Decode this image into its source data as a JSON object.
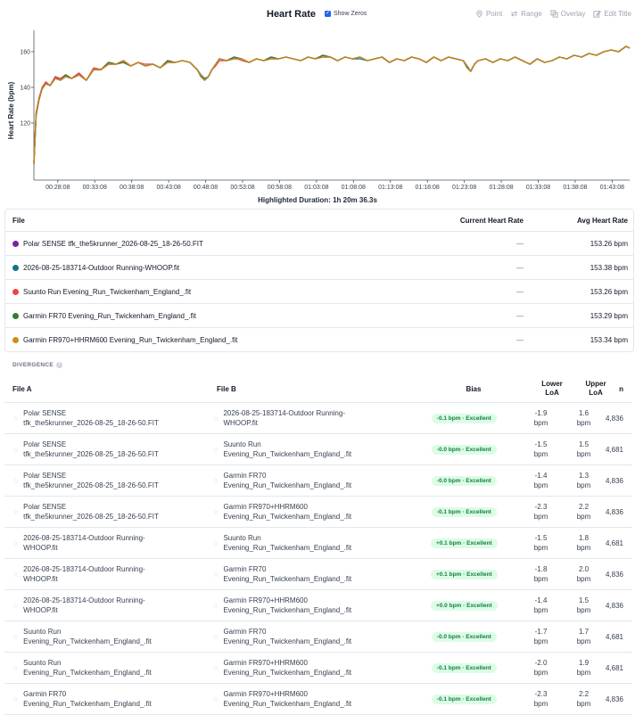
{
  "header": {
    "title": "Heart Rate",
    "show_zeros_label": "Show Zeros",
    "tools": [
      {
        "label": "Point",
        "icon": "pin-icon"
      },
      {
        "label": "Range",
        "icon": "range-icon"
      },
      {
        "label": "Overlay",
        "icon": "overlay-icon"
      },
      {
        "label": "Edit Title",
        "icon": "edit-icon"
      }
    ]
  },
  "chart_data": {
    "type": "line",
    "title": "Heart Rate",
    "ylabel": "Heart Rate (bpm)",
    "xlabel": "Highlighted Duration: 1h 20m 36.3s",
    "x_tick_labels": [
      "00:28:08",
      "00:33:08",
      "00:38:08",
      "00:43:08",
      "00:48:08",
      "00:53:08",
      "00:58:08",
      "01:03:08",
      "01:08:08",
      "01:13:08",
      "01:18:08",
      "01:23:08",
      "01:28:08",
      "01:33:08",
      "01:38:08",
      "01:43:08"
    ],
    "y_ticks": [
      120,
      140,
      160
    ],
    "ylim": [
      88,
      172
    ],
    "x_minutes": [
      24.9,
      25.2,
      25.6,
      26.0,
      26.5,
      27.1,
      27.8,
      28.5,
      29.2,
      30.0,
      31.0,
      32.0,
      33.0,
      34.0,
      35.0,
      36.0,
      37.0,
      38.0,
      39.0,
      40.0,
      41.0,
      42.0,
      43.0,
      44.0,
      45.0,
      46.0,
      47.0,
      47.5,
      48.0,
      48.5,
      49.0,
      49.5,
      50.0,
      51.0,
      52.0,
      53.0,
      54.0,
      55.0,
      56.0,
      57.0,
      58.0,
      59.0,
      60.0,
      61.0,
      62.0,
      63.0,
      64.0,
      65.0,
      66.0,
      67.0,
      68.0,
      69.0,
      70.0,
      71.0,
      72.0,
      73.0,
      74.0,
      75.0,
      76.0,
      77.0,
      78.0,
      79.0,
      80.0,
      81.0,
      82.0,
      83.0,
      83.5,
      84.0,
      84.5,
      85.0,
      86.0,
      87.0,
      88.0,
      89.0,
      90.0,
      91.0,
      92.0,
      93.0,
      94.0,
      95.0,
      96.0,
      97.0,
      98.0,
      99.0,
      100.0,
      101.0,
      102.0,
      103.0,
      104.0,
      105.0,
      105.5
    ],
    "series": [
      {
        "name": "Polar SENSE tfk_the5krunner_2026-08-25_18-26-50.FIT",
        "color": "#7b1fa2",
        "values": [
          98,
          125,
          134,
          139,
          143,
          141,
          146,
          144,
          147,
          145,
          148,
          144,
          150,
          150,
          154,
          153,
          155,
          152,
          154,
          152,
          153,
          151,
          155,
          154,
          155,
          154,
          150,
          146,
          144,
          146,
          150,
          153,
          156,
          155,
          157,
          156,
          154,
          156,
          155,
          157,
          156,
          157,
          156,
          155,
          157,
          156,
          158,
          157,
          155,
          157,
          156,
          157,
          155,
          156,
          157,
          154,
          156,
          155,
          157,
          156,
          154,
          157,
          155,
          157,
          156,
          155,
          151,
          149,
          153,
          155,
          156,
          154,
          156,
          155,
          157,
          155,
          153,
          156,
          154,
          155,
          157,
          156,
          158,
          157,
          159,
          158,
          160,
          161,
          160,
          163,
          162
        ]
      },
      {
        "name": "2026-08-25-183714-Outdoor Running-WHOOP.fit",
        "color": "#0e7490",
        "values": [
          97,
          124,
          133,
          139,
          142,
          141,
          145,
          144,
          146,
          145,
          147,
          144,
          150,
          150,
          153,
          153,
          154,
          152,
          154,
          152,
          153,
          151,
          154,
          154,
          155,
          154,
          150,
          147,
          145,
          146,
          150,
          153,
          156,
          155,
          156,
          156,
          154,
          156,
          155,
          156,
          156,
          157,
          156,
          155,
          157,
          156,
          157,
          157,
          155,
          157,
          156,
          156,
          155,
          156,
          157,
          154,
          156,
          155,
          157,
          156,
          154,
          157,
          155,
          157,
          156,
          155,
          152,
          149,
          153,
          155,
          156,
          154,
          156,
          155,
          157,
          155,
          153,
          156,
          154,
          155,
          157,
          156,
          158,
          157,
          159,
          158,
          160,
          161,
          160,
          163,
          162
        ]
      },
      {
        "name": "Suunto Run Evening_Run_Twickenham_England_.fit",
        "color": "#ef4444",
        "values": [
          98,
          126,
          134,
          140,
          143,
          141,
          146,
          145,
          147,
          145,
          148,
          144,
          151,
          150,
          154,
          153,
          155,
          152,
          154,
          153,
          153,
          151,
          155,
          154,
          155,
          154,
          150,
          146,
          144,
          146,
          150,
          152,
          155,
          155,
          157,
          155,
          154,
          156,
          155,
          157,
          156,
          157,
          156,
          155,
          157,
          156,
          158,
          157,
          155,
          157,
          156,
          157,
          155,
          156,
          157,
          154,
          156,
          155,
          157,
          156,
          154,
          157,
          155,
          157,
          156,
          155,
          151,
          149,
          153,
          155,
          156,
          154,
          156,
          155,
          157,
          155,
          153,
          156,
          154,
          155,
          157,
          156,
          158,
          157,
          159,
          158,
          160,
          161,
          160,
          163,
          162
        ]
      },
      {
        "name": "Garmin FR70 Evening_Run_Twickenham_England_.fit",
        "color": "#2e7d32",
        "values": [
          97,
          125,
          133,
          139,
          142,
          141,
          145,
          144,
          147,
          145,
          147,
          144,
          150,
          150,
          154,
          153,
          154,
          152,
          154,
          152,
          153,
          151,
          155,
          154,
          155,
          154,
          150,
          146,
          144,
          146,
          150,
          153,
          156,
          155,
          157,
          156,
          154,
          156,
          155,
          157,
          156,
          157,
          156,
          155,
          157,
          156,
          158,
          157,
          155,
          157,
          156,
          157,
          155,
          156,
          157,
          154,
          156,
          155,
          157,
          156,
          154,
          157,
          155,
          157,
          156,
          155,
          151,
          149,
          153,
          155,
          156,
          154,
          156,
          155,
          157,
          155,
          153,
          156,
          154,
          155,
          157,
          156,
          158,
          157,
          159,
          158,
          160,
          161,
          160,
          163,
          162
        ]
      },
      {
        "name": "Garmin FR970+HHRM600 Evening_Run_Twickenham_England_.fit",
        "color": "#d4881a",
        "values": [
          97,
          125,
          133,
          139,
          142,
          141,
          145,
          144,
          146,
          145,
          147,
          144,
          150,
          150,
          153,
          153,
          155,
          152,
          154,
          152,
          153,
          151,
          154,
          154,
          155,
          154,
          150,
          146,
          144,
          146,
          150,
          153,
          156,
          155,
          156,
          156,
          154,
          156,
          155,
          156,
          156,
          157,
          156,
          155,
          157,
          156,
          157,
          157,
          155,
          157,
          156,
          157,
          155,
          156,
          157,
          154,
          156,
          155,
          157,
          156,
          154,
          157,
          155,
          157,
          156,
          155,
          151,
          149,
          153,
          155,
          156,
          154,
          156,
          155,
          157,
          155,
          153,
          156,
          154,
          155,
          157,
          156,
          158,
          157,
          159,
          158,
          160,
          161,
          160,
          163,
          162
        ]
      }
    ]
  },
  "file_table": {
    "headers": {
      "file": "File",
      "current": "Current Heart Rate",
      "avg": "Avg Heart Rate"
    },
    "rows": [
      {
        "file": "Polar SENSE tfk_the5krunner_2026-08-25_18-26-50.FIT",
        "color": "#7b1fa2",
        "current": "—",
        "avg": "153.26 bpm"
      },
      {
        "file": "2026-08-25-183714-Outdoor Running-WHOOP.fit",
        "color": "#0e7490",
        "current": "—",
        "avg": "153.38 bpm"
      },
      {
        "file": "Suunto Run Evening_Run_Twickenham_England_.fit",
        "color": "#ef4444",
        "current": "—",
        "avg": "153.26 bpm"
      },
      {
        "file": "Garmin FR70 Evening_Run_Twickenham_England_.fit",
        "color": "#2e7d32",
        "current": "—",
        "avg": "153.29 bpm"
      },
      {
        "file": "Garmin FR970+HHRM600 Evening_Run_Twickenham_England_.fit",
        "color": "#d4881a",
        "current": "—",
        "avg": "153.34 bpm"
      }
    ]
  },
  "divergence": {
    "title": "DIVERGENCE",
    "headers": {
      "file_a": "File A",
      "file_b": "File B",
      "bias": "Bias",
      "lower_1": "Lower",
      "lower_2": "LoA",
      "upper_1": "Upper",
      "upper_2": "LoA",
      "n": "n"
    },
    "rows": [
      {
        "a1": "Polar SENSE",
        "a2": "tfk_the5krunner_2026-08-25_18-26-50.FIT",
        "b1": "2026-08-25-183714-Outdoor Running-",
        "b2": "WHOOP.fit",
        "bias": "-0.1 bpm · Excellent",
        "lo1": "-1.9",
        "lo2": "bpm",
        "up1": "1.6",
        "up2": "bpm",
        "n": "4,836"
      },
      {
        "a1": "Polar SENSE",
        "a2": "tfk_the5krunner_2026-08-25_18-26-50.FIT",
        "b1": "Suunto Run",
        "b2": "Evening_Run_Twickenham_England_.fit",
        "bias": "-0.0 bpm · Excellent",
        "lo1": "-1.5",
        "lo2": "bpm",
        "up1": "1.5",
        "up2": "bpm",
        "n": "4,681"
      },
      {
        "a1": "Polar SENSE",
        "a2": "tfk_the5krunner_2026-08-25_18-26-50.FIT",
        "b1": "Garmin FR70",
        "b2": "Evening_Run_Twickenham_England_.fit",
        "bias": "-0.0 bpm · Excellent",
        "lo1": "-1.4",
        "lo2": "bpm",
        "up1": "1.3",
        "up2": "bpm",
        "n": "4,836"
      },
      {
        "a1": "Polar SENSE",
        "a2": "tfk_the5krunner_2026-08-25_18-26-50.FIT",
        "b1": "Garmin FR970+HHRM600",
        "b2": "Evening_Run_Twickenham_England_.fit",
        "bias": "-0.1 bpm · Excellent",
        "lo1": "-2.3",
        "lo2": "bpm",
        "up1": "2.2",
        "up2": "bpm",
        "n": "4,836"
      },
      {
        "a1": "2026-08-25-183714-Outdoor Running-",
        "a2": "WHOOP.fit",
        "b1": "Suunto Run",
        "b2": "Evening_Run_Twickenham_England_.fit",
        "bias": "+0.1 bpm · Excellent",
        "lo1": "-1.5",
        "lo2": "bpm",
        "up1": "1.8",
        "up2": "bpm",
        "n": "4,681"
      },
      {
        "a1": "2026-08-25-183714-Outdoor Running-",
        "a2": "WHOOP.fit",
        "b1": "Garmin FR70",
        "b2": "Evening_Run_Twickenham_England_.fit",
        "bias": "+0.1 bpm · Excellent",
        "lo1": "-1.8",
        "lo2": "bpm",
        "up1": "2.0",
        "up2": "bpm",
        "n": "4,836"
      },
      {
        "a1": "2026-08-25-183714-Outdoor Running-",
        "a2": "WHOOP.fit",
        "b1": "Garmin FR970+HHRM600",
        "b2": "Evening_Run_Twickenham_England_.fit",
        "bias": "+0.0 bpm · Excellent",
        "lo1": "-1.4",
        "lo2": "bpm",
        "up1": "1.5",
        "up2": "bpm",
        "n": "4,836"
      },
      {
        "a1": "Suunto Run",
        "a2": "Evening_Run_Twickenham_England_.fit",
        "b1": "Garmin FR70",
        "b2": "Evening_Run_Twickenham_England_.fit",
        "bias": "-0.0 bpm · Excellent",
        "lo1": "-1.7",
        "lo2": "bpm",
        "up1": "1.7",
        "up2": "bpm",
        "n": "4,681"
      },
      {
        "a1": "Suunto Run",
        "a2": "Evening_Run_Twickenham_England_.fit",
        "b1": "Garmin FR970+HHRM600",
        "b2": "Evening_Run_Twickenham_England_.fit",
        "bias": "-0.1 bpm · Excellent",
        "lo1": "-2.0",
        "lo2": "bpm",
        "up1": "1.9",
        "up2": "bpm",
        "n": "4,681"
      },
      {
        "a1": "Garmin FR70",
        "a2": "Evening_Run_Twickenham_England_.fit",
        "b1": "Garmin FR970+HHRM600",
        "b2": "Evening_Run_Twickenham_England_.fit",
        "bias": "-0.1 bpm · Excellent",
        "lo1": "-2.3",
        "lo2": "bpm",
        "up1": "2.2",
        "up2": "bpm",
        "n": "4,836"
      }
    ]
  }
}
